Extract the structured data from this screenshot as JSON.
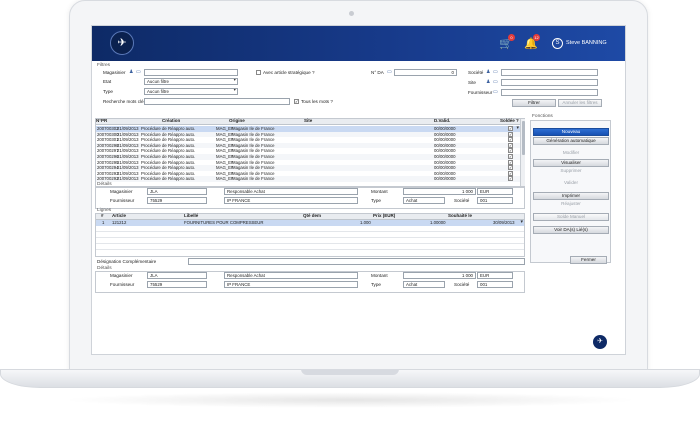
{
  "app": {
    "user": {
      "initial": "S",
      "name": "Steve BANNING"
    },
    "cart_badge": "0",
    "bell_badge": "12",
    "logo_glyph": "✈",
    "icons": {
      "logo": "plane-icon",
      "cart": "cart-icon",
      "bell": "bell-icon"
    }
  },
  "filters": {
    "section_title": "Filtres",
    "magasinier_label": "Magasinier",
    "magasinier_value": "",
    "etat_label": "Etat",
    "etat_value": "Aucun filtre",
    "type_label": "Type",
    "type_value": "Aucun filtre",
    "recherche_label": "Recherche mots clés",
    "recherche_value": "",
    "article_strategique_label": "Avec article stratégique ?",
    "tous_les_mots_label": "Tous les mots ?",
    "tous_les_mots_checked": "✓",
    "nda_label": "N° DA",
    "nda_value": "0",
    "societe_label": "Société",
    "site_label": "Site",
    "fournisseur_label": "Fournisseur",
    "filtrer_button": "Filtrer",
    "annuler_button": "Annuler les filtres"
  },
  "da_table": {
    "headers": [
      "N°PR",
      "Création",
      "Origine",
      "Site",
      "D.Valid.",
      "Soldée ?"
    ],
    "rows": [
      {
        "npr": "200700302",
        "creation": "21/09/2013",
        "origine": "Procédure de Réappro auto.",
        "site_code": "MAG_EF",
        "site_name": "Magasin Ile de France",
        "dvalid": "00/00/0000",
        "soldee": "✓"
      },
      {
        "npr": "200700300",
        "creation": "21/09/2013",
        "origine": "Procédure de Réappro auto.",
        "site_code": "MAG_EF",
        "site_name": "Magasin Ile de France",
        "dvalid": "00/00/0000",
        "soldee": "✓"
      },
      {
        "npr": "200700301",
        "creation": "21/09/2013",
        "origine": "Procédure de Réappro auto.",
        "site_code": "MAG_EF",
        "site_name": "Magasin Ile de France",
        "dvalid": "00/00/0000",
        "soldee": "✓"
      },
      {
        "npr": "200700298",
        "creation": "21/09/2013",
        "origine": "Procédure de Réappro auto.",
        "site_code": "MAG_EF",
        "site_name": "Magasin Ile de France",
        "dvalid": "00/00/0000",
        "soldee": "✓"
      },
      {
        "npr": "200700297",
        "creation": "21/09/2013",
        "origine": "Procédure de Réappro auto.",
        "site_code": "MAG_EF",
        "site_name": "Magasin Ile de France",
        "dvalid": "00/00/0000",
        "soldee": "✓"
      },
      {
        "npr": "200700296",
        "creation": "21/09/2013",
        "origine": "Procédure de Réappro auto.",
        "site_code": "MAG_EF",
        "site_name": "Magasin Ile de France",
        "dvalid": "00/00/0000",
        "soldee": "✓"
      },
      {
        "npr": "200700295",
        "creation": "21/09/2013",
        "origine": "Procédure de Réappro auto.",
        "site_code": "MAG_EF",
        "site_name": "Magasin Ile de France",
        "dvalid": "00/00/0000",
        "soldee": "✓"
      },
      {
        "npr": "200700294",
        "creation": "21/09/2013",
        "origine": "Procédure de Réappro auto.",
        "site_code": "MAG_EF",
        "site_name": "Magasin Ile de France",
        "dvalid": "00/00/0000",
        "soldee": "✓"
      },
      {
        "npr": "200700293",
        "creation": "21/09/2013",
        "origine": "Procédure de Réappro auto.",
        "site_code": "MAG_EF",
        "site_name": "Magasin Ile de France",
        "dvalid": "00/00/0000",
        "soldee": "✓"
      },
      {
        "npr": "200700292",
        "creation": "21/09/2013",
        "origine": "Procédure de Réappro auto.",
        "site_code": "MAG_EF",
        "site_name": "Magasin Ile de France",
        "dvalid": "00/00/0000",
        "soldee": "✓"
      }
    ]
  },
  "details1": {
    "section_title": "Détails",
    "magasinier_label": "Magasinier",
    "magasinier_code": "JLA",
    "magasinier_name": "Responsable Achat",
    "fournisseur_label": "Fournisseur",
    "fournisseur_code": "75529",
    "fournisseur_name": "IP FRANCE",
    "montant_label": "Montant",
    "montant_value": "1 000",
    "devise_value": "EUR",
    "type_label": "Type",
    "type_value": "Achat",
    "societe_label": "Société",
    "societe_value": "001"
  },
  "lignes": {
    "section_title": "Lignes",
    "headers": [
      "#",
      "Article",
      "Libellé",
      "Qté dem",
      "Prix (EUR)",
      "Souhaité le"
    ],
    "rows": [
      {
        "num": "1",
        "article": "121212",
        "libelle": "FOURNITURES POUR COMPRESSEUR",
        "qte": "1.000",
        "prix": "1.00000",
        "souhaite": "30/09/2013"
      }
    ]
  },
  "designation": {
    "label": "Désignation Complémentaire",
    "value": ""
  },
  "details2": {
    "section_title": "Détails",
    "magasinier_label": "Magasinier",
    "magasinier_code": "JLA",
    "magasinier_name": "Responsable Achat",
    "fournisseur_label": "Fournisseur",
    "fournisseur_code": "75529",
    "fournisseur_name": "IP FRANCE",
    "montant_label": "Montant",
    "montant_value": "1 000",
    "devise_value": "EUR",
    "type_label": "Type",
    "type_value": "Achat",
    "societe_label": "Société",
    "societe_value": "001"
  },
  "functions": {
    "title": "Fonctions",
    "nouveau": "Nouveau",
    "generation": "Génération automatique",
    "modifier": "Modifier",
    "visualiser": "Visualiser",
    "supprimer": "Supprimer",
    "valider": "Valider",
    "imprimer": "Imprimer",
    "reajuster": "Réajuster",
    "solde_manuel": "Solde Manuel",
    "voir_da": "Voir DA(s) Lié(s)",
    "fermer": "Fermer"
  }
}
